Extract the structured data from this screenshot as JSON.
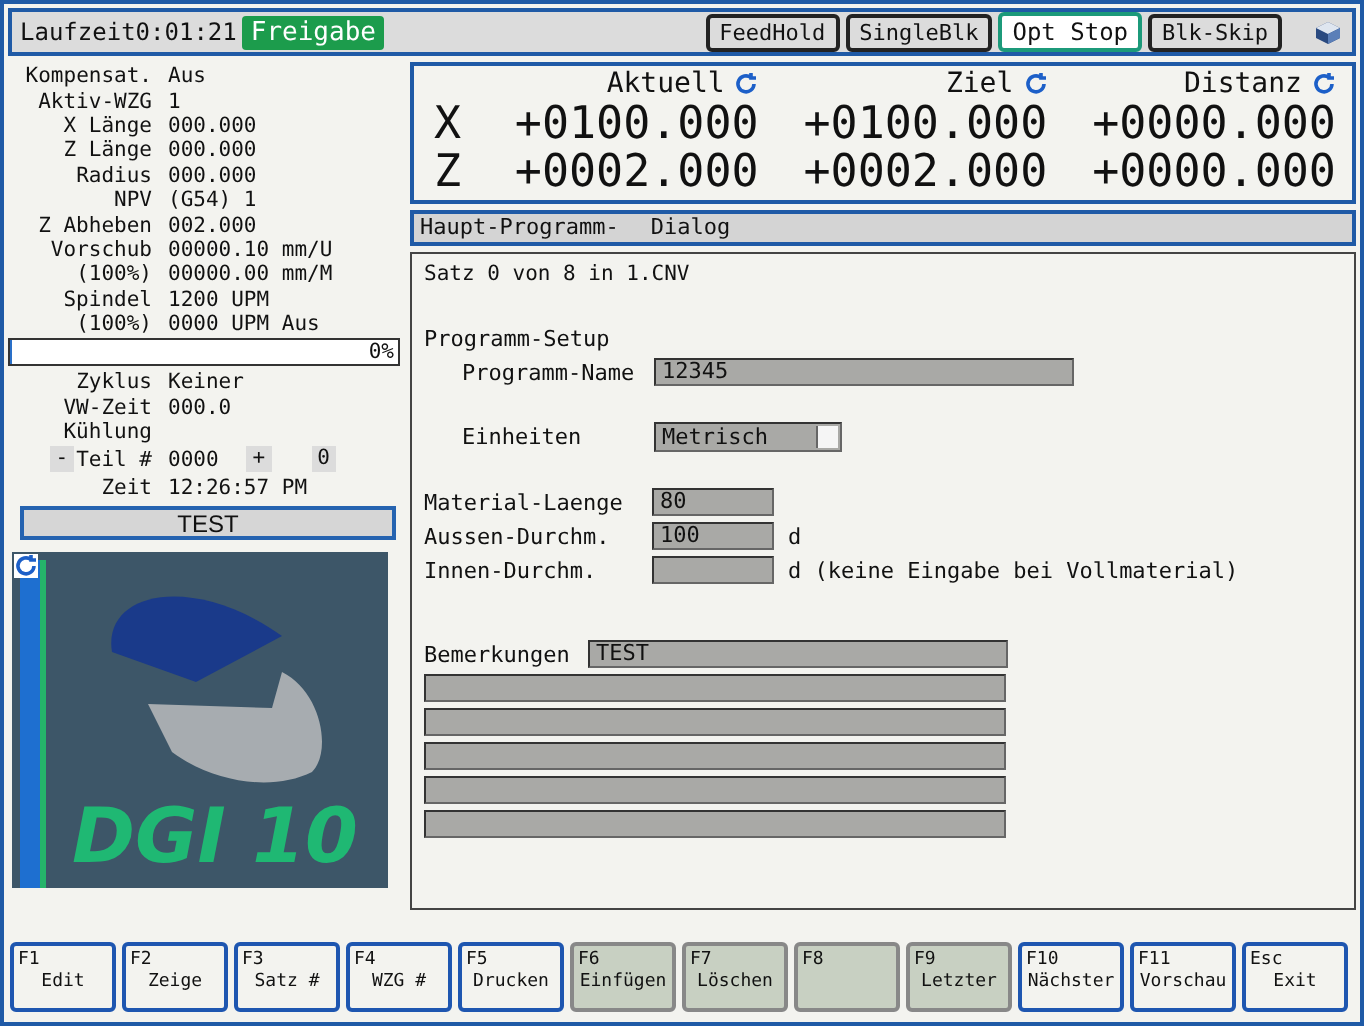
{
  "top_bar": {
    "runtime_label": "Laufzeit",
    "runtime": "0:01:21",
    "release": "Freigabe",
    "toggles": [
      {
        "label": "FeedHold",
        "on": false
      },
      {
        "label": "SingleBlk",
        "on": false
      },
      {
        "label": "Opt Stop",
        "on": true
      },
      {
        "label": "Blk-Skip",
        "on": false
      }
    ]
  },
  "status_panel": {
    "rows": [
      {
        "label": "Kompensat.",
        "value": "Aus"
      },
      {
        "label": "Aktiv-WZG",
        "value": "1"
      },
      {
        "label": "X Länge",
        "value": "000.000"
      },
      {
        "label": "Z Länge",
        "value": "000.000"
      },
      {
        "label": "Radius",
        "value": "000.000"
      },
      {
        "label": "NPV",
        "value": "(G54) 1"
      },
      {
        "label": "Z Abheben",
        "value": "002.000"
      },
      {
        "label": "Vorschub",
        "value": "00000.10 mm/U"
      },
      {
        "label": "(100%)",
        "value": "00000.00 mm/M"
      },
      {
        "label": "Spindel",
        "value": "1200 UPM"
      },
      {
        "label": "(100%)",
        "value": "0000 UPM Aus"
      }
    ],
    "progress": {
      "level": 0,
      "reading": "0%"
    },
    "rows_2": [
      {
        "label": "Zyklus",
        "value": "Keiner"
      },
      {
        "label": "VW-Zeit",
        "value": "000.0"
      },
      {
        "label": "Kühlung"
      }
    ],
    "part": {
      "minus": "-",
      "label": "Teil #",
      "value": "0000",
      "plus": "+",
      "count": "0"
    },
    "time": {
      "label": "Zeit",
      "value": "12:26:57 PM"
    },
    "test_button": "TEST",
    "logo": {
      "text": "DGI 10"
    }
  },
  "dro": {
    "columns": [
      {
        "title": "Aktuell"
      },
      {
        "title": "Ziel"
      },
      {
        "title": "Distanz"
      }
    ],
    "axes": [
      {
        "axis": "X",
        "values": [
          "+0100.000",
          "+0100.000",
          "+0000.000"
        ]
      },
      {
        "axis": "Z",
        "values": [
          "+0002.000",
          "+0002.000",
          "+0000.000"
        ]
      }
    ]
  },
  "program": {
    "header": [
      "Haupt-Programm-",
      "Dialog"
    ],
    "status": "Satz 0 von 8 in 1.CNV",
    "section": "Programm-Setup",
    "name_field": {
      "label": "Programm-Name",
      "value": "12345"
    },
    "units_field": {
      "label": "Einheiten",
      "value": "Metrisch"
    },
    "material_fields": [
      {
        "label": "Material-Laenge",
        "value": "80"
      },
      {
        "label": "Aussen-Durchm.",
        "value": "100",
        "unit": "d"
      },
      {
        "label": "Innen-Durchm.",
        "unit": "d (keine Eingabe bei Vollmaterial)"
      }
    ],
    "remarks": {
      "label": "Bemerkungen",
      "value": "TEST"
    }
  },
  "function_keys": [
    {
      "key": "F1",
      "label": "Edit",
      "disabled": false
    },
    {
      "key": "F2",
      "label": "Zeige",
      "disabled": false
    },
    {
      "key": "F3",
      "label": "Satz #",
      "disabled": false
    },
    {
      "key": "F4",
      "label": "WZG #",
      "disabled": false
    },
    {
      "key": "F5",
      "label": "Drucken",
      "disabled": false
    },
    {
      "key": "F6",
      "label": "Einfügen",
      "disabled": true
    },
    {
      "key": "F7",
      "label": "Löschen",
      "disabled": true
    },
    {
      "key": "F8",
      "disabled": true
    },
    {
      "key": "F9",
      "label": "Letzter",
      "disabled": true
    },
    {
      "key": "F10",
      "label": "Nächster",
      "disabled": false
    },
    {
      "key": "F11",
      "label": "Vorschau",
      "disabled": false
    },
    {
      "key": "Esc",
      "label": "Exit",
      "disabled": false
    }
  ]
}
